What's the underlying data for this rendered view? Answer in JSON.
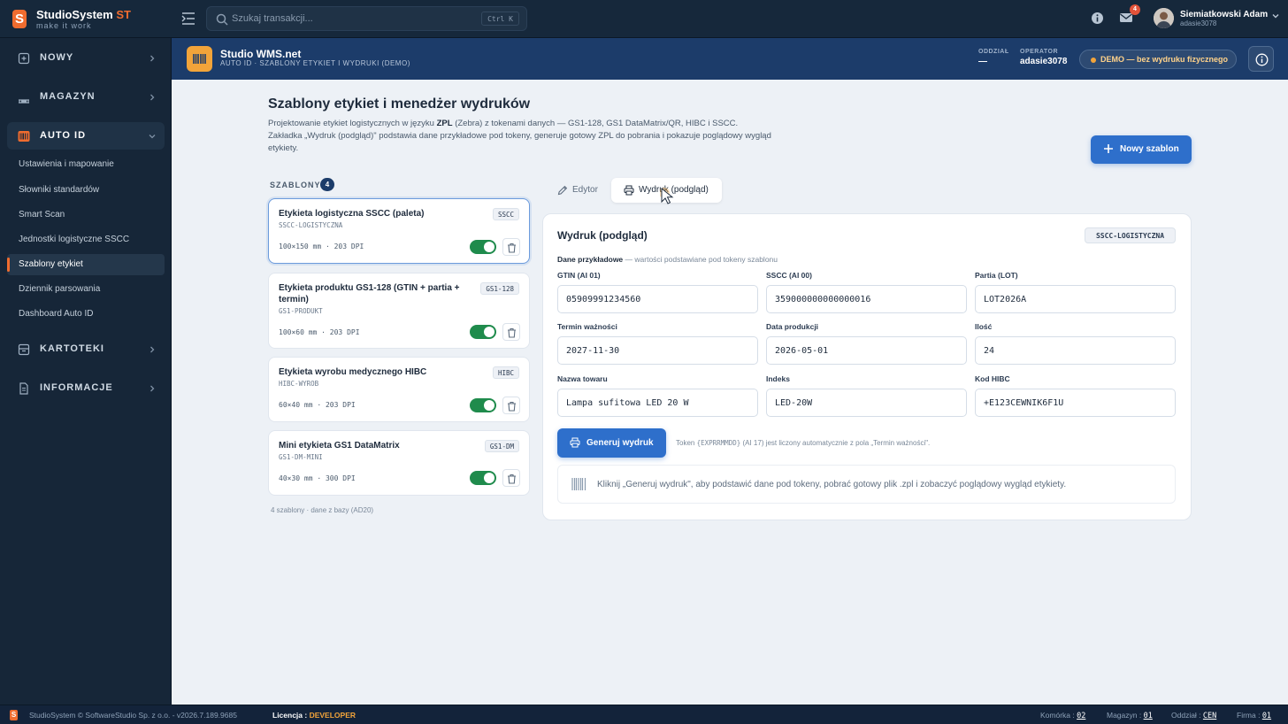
{
  "app": {
    "name": "StudioSystem",
    "suffix": "ST",
    "tagline": "make it work",
    "logo_letter": "S",
    "accent": "#ef6c2f"
  },
  "topbar": {
    "search_placeholder": "Szukaj transakcji...",
    "search_shortcut": "Ctrl K",
    "mail_count": "4",
    "user": {
      "name": "Siemiatkowski Adam",
      "login": "adasie3078"
    }
  },
  "sidebar": {
    "sections": [
      {
        "label": "NOWY",
        "icon": "plus-square-icon"
      },
      {
        "label": "MAGAZYN",
        "icon": "warehouse-icon"
      },
      {
        "label": "AUTO ID",
        "icon": "barcode-icon",
        "expanded": true
      },
      {
        "label": "KARTOTEKI",
        "icon": "archive-icon"
      },
      {
        "label": "INFORMACJE",
        "icon": "document-icon"
      }
    ],
    "sub_items": [
      {
        "label": "Ustawienia i mapowanie"
      },
      {
        "label": "Słowniki standardów"
      },
      {
        "label": "Smart Scan"
      },
      {
        "label": "Jednostki logistyczne SSCC"
      },
      {
        "label": "Szablony etykiet",
        "active": true
      },
      {
        "label": "Dziennik parsowania"
      },
      {
        "label": "Dashboard Auto ID"
      }
    ]
  },
  "banner": {
    "title": "Studio WMS.net",
    "subtitle": "AUTO ID · SZABLONY ETYKIET I WYDRUKI (DEMO)",
    "branch_label": "ODDZIAŁ",
    "branch_value": "—",
    "operator_label": "OPERATOR",
    "operator_value": "adasie3078",
    "demo_text": "DEMO — bez wydruku fizycznego"
  },
  "page": {
    "title": "Szablony etykiet i menedżer wydruków",
    "desc_1": "Projektowanie etykiet logistycznych w języku ",
    "desc_bold": "ZPL",
    "desc_2": " (Zebra) z tokenami danych — GS1-128, GS1 DataMatrix/QR, HIBC i SSCC.",
    "desc_3": "Zakładka „Wydruk (podgląd)\" podstawia dane przykładowe pod tokeny, generuje gotowy ZPL do pobrania i pokazuje poglądowy wygląd etykiety.",
    "new_button": "Nowy szablon"
  },
  "templates": {
    "heading": "SZABLONY",
    "count": "4",
    "items": [
      {
        "name": "Etykieta logistyczna SSCC (paleta)",
        "code": "SSCC-LOGISTYCZNA",
        "tag": "SSCC",
        "meta": "100×150 mm · 203 DPI",
        "enabled": true,
        "selected": true
      },
      {
        "name": "Etykieta produktu GS1-128 (GTIN + partia + termin)",
        "code": "GS1-PRODUKT",
        "tag": "GS1-128",
        "meta": "100×60 mm · 203 DPI",
        "enabled": true
      },
      {
        "name": "Etykieta wyrobu medycznego HIBC",
        "code": "HIBC-WYROB",
        "tag": "HIBC",
        "meta": "60×40 mm · 203 DPI",
        "enabled": true
      },
      {
        "name": "Mini etykieta GS1 DataMatrix",
        "code": "GS1-DM-MINI",
        "tag": "GS1-DM",
        "meta": "40×30 mm · 300 DPI",
        "enabled": true
      }
    ],
    "footer": "4 szablony · dane z bazy (AD20)"
  },
  "tabs": [
    {
      "label": "Edytor",
      "active": false
    },
    {
      "label": "Wydruk (podgląd)",
      "active": true
    }
  ],
  "preview": {
    "title": "Wydruk (podgląd)",
    "template_code": "SSCC-LOGISTYCZNA",
    "sample_heading": "Dane przykładowe",
    "sample_note": " — wartości podstawiane pod tokeny szablonu",
    "fields": [
      {
        "label": "GTIN (AI 01)",
        "value": "05909991234560"
      },
      {
        "label": "SSCC (AI 00)",
        "value": "359000000000000016"
      },
      {
        "label": "Partia (LOT)",
        "value": "LOT2026A"
      },
      {
        "label": "Termin ważności",
        "value": "2027-11-30"
      },
      {
        "label": "Data produkcji",
        "value": "2026-05-01"
      },
      {
        "label": "Ilość",
        "value": "24"
      },
      {
        "label": "Nazwa towaru",
        "value": "Lampa sufitowa LED 20 W"
      },
      {
        "label": "Indeks",
        "value": "LED-20W"
      },
      {
        "label": "Kod HIBC",
        "value": "+E123CEWNIK6F1U"
      }
    ],
    "generate_button": "Generuj wydruk",
    "note_pre": "Token ",
    "note_token": "{EXPRRMMDD}",
    "note_post": " (AI 17) jest liczony automatycznie z pola „Termin ważności\".",
    "hint": "Kliknij „Generuj wydruk\", aby podstawić dane pod tokeny, pobrać gotowy plik .zpl i zobaczyć poglądowy wygląd etykiety."
  },
  "footer": {
    "copyright": "StudioSystem © SoftwareStudio Sp. z o.o. - v2026.7.189.9685",
    "license_label": "Licencja : ",
    "license_value": "DEVELOPER",
    "cell_label": "Komórka : ",
    "cell_value": "02",
    "warehouse_label": "Magazyn : ",
    "warehouse_value": "01",
    "branch_label": "Oddział : ",
    "branch_value": "CEN",
    "company_label": "Firma : ",
    "company_value": "01"
  }
}
